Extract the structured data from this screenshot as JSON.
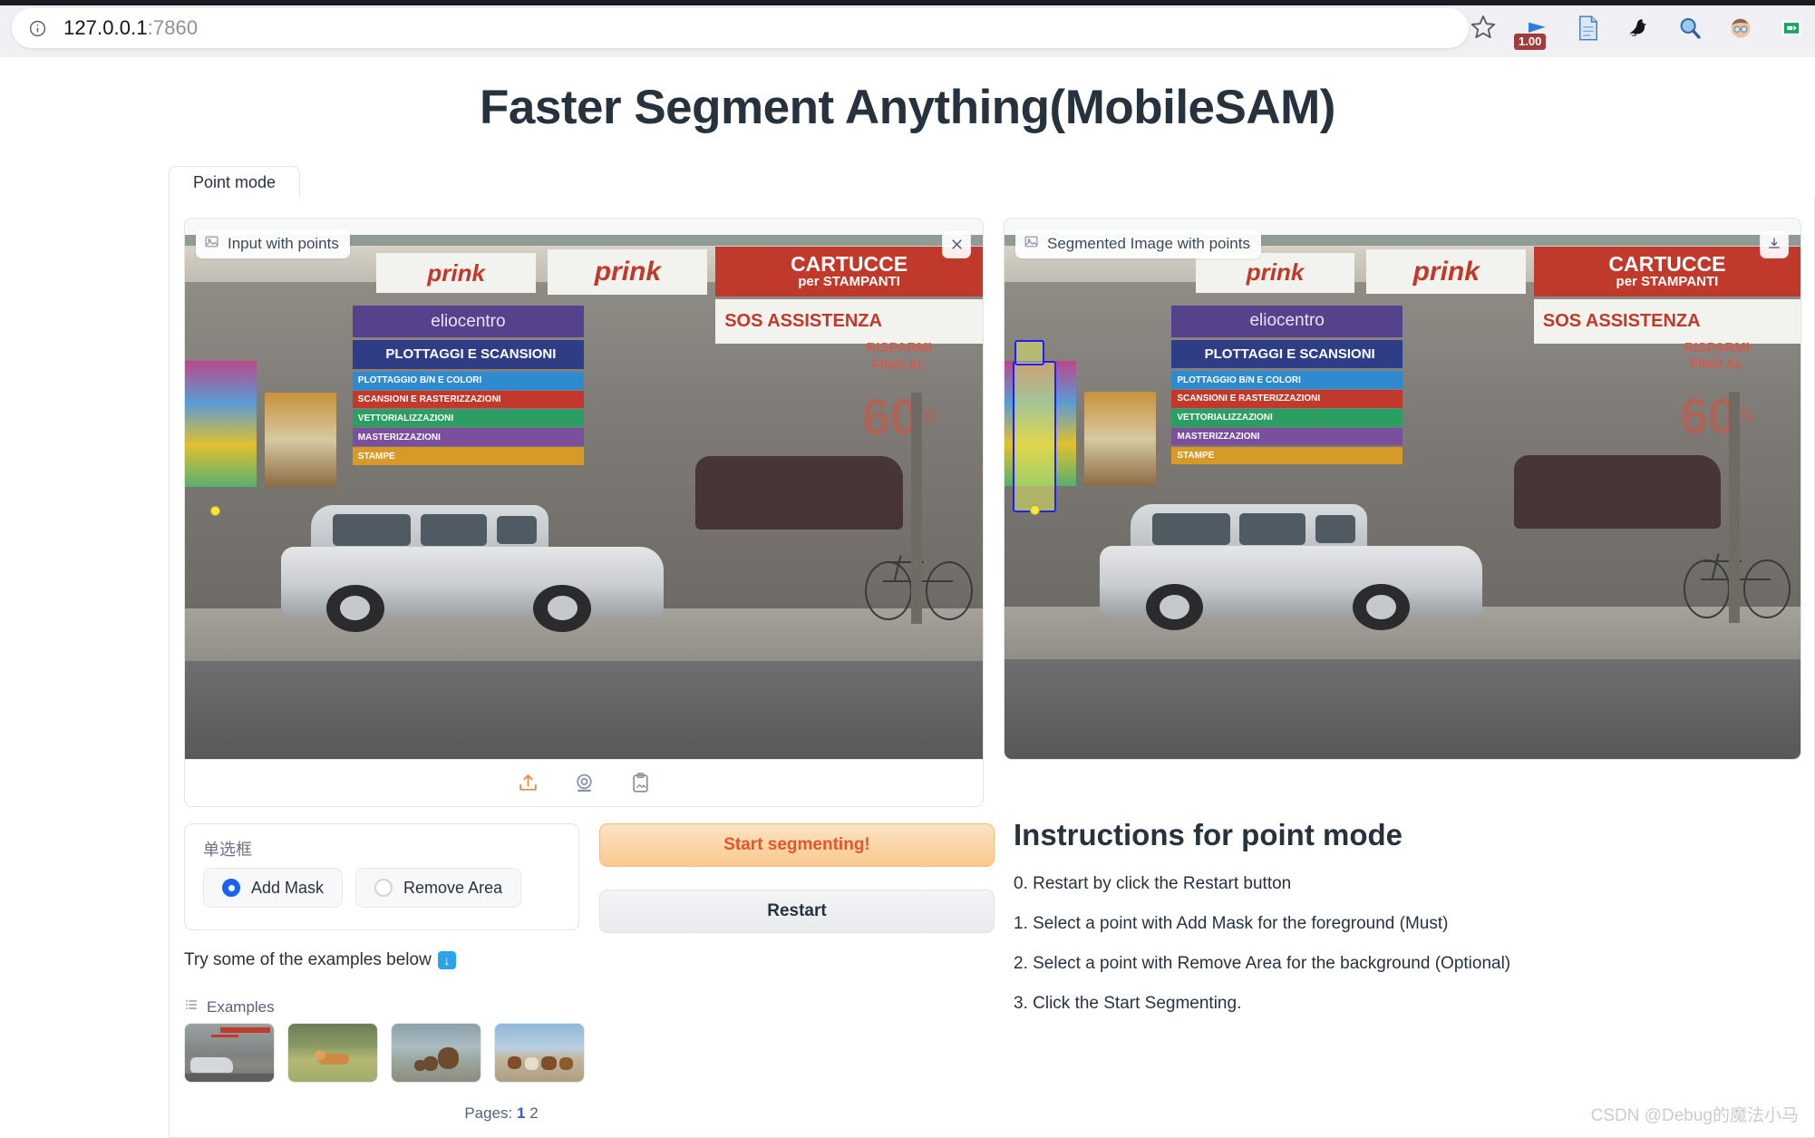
{
  "browser": {
    "url_host": "127.0.0.1",
    "url_port": ":7860",
    "info_icon": "info-circle-icon",
    "star_icon": "bookmark-star-icon",
    "toolbar_icons": [
      {
        "name": "speed-play-icon",
        "badge": "1.00"
      },
      {
        "name": "document-reader-icon",
        "badge": ""
      },
      {
        "name": "bird-extension-icon",
        "badge": ""
      },
      {
        "name": "search-magnifier-icon",
        "badge": ""
      },
      {
        "name": "account-avatar-icon",
        "badge": ""
      },
      {
        "name": "green-extension-icon",
        "badge": ""
      }
    ]
  },
  "app": {
    "title": "Faster Segment Anything(MobileSAM)"
  },
  "tabs": [
    {
      "label": "Point mode",
      "active": true
    }
  ],
  "images": {
    "input": {
      "label": "Input with points",
      "label_icon": "image-placeholder-icon",
      "close_icon": "close-icon",
      "tools": [
        {
          "name": "upload-icon",
          "label": "Upload"
        },
        {
          "name": "webcam-icon",
          "label": "Webcam"
        },
        {
          "name": "paste-clipboard-icon",
          "label": "Paste from clipboard"
        }
      ]
    },
    "output": {
      "label": "Segmented Image with points",
      "label_icon": "image-placeholder-icon",
      "download_icon": "download-icon"
    }
  },
  "controls": {
    "radio_label": "单选框",
    "options": [
      {
        "label": "Add Mask",
        "selected": true
      },
      {
        "label": "Remove Area",
        "selected": false
      }
    ],
    "start_button": "Start segmenting!",
    "restart_button": "Restart",
    "start_button_color": "#e2562a",
    "start_button_bg": "#f9c98f"
  },
  "instructions": {
    "title": "Instructions for point mode",
    "lines": [
      "0. Restart by click the Restart button",
      "1. Select a point with Add Mask for the foreground (Must)",
      "2. Select a point with Remove Area for the background (Optional)",
      "3. Click the Start Segmenting."
    ]
  },
  "examples": {
    "hint": "Try some of the examples below",
    "hint_icon": "arrow-down-emoji-icon",
    "header": "Examples",
    "header_icon": "list-icon",
    "thumbs": [
      {
        "alt": "car in front of print shop"
      },
      {
        "alt": "corgi dog running on grass"
      },
      {
        "alt": "bears by the water"
      },
      {
        "alt": "herd of horses running"
      }
    ],
    "pager_label": "Pages:",
    "pages": [
      "1",
      "2"
    ],
    "active_page": "1"
  },
  "watermark": "CSDN @Debug的魔法小马"
}
